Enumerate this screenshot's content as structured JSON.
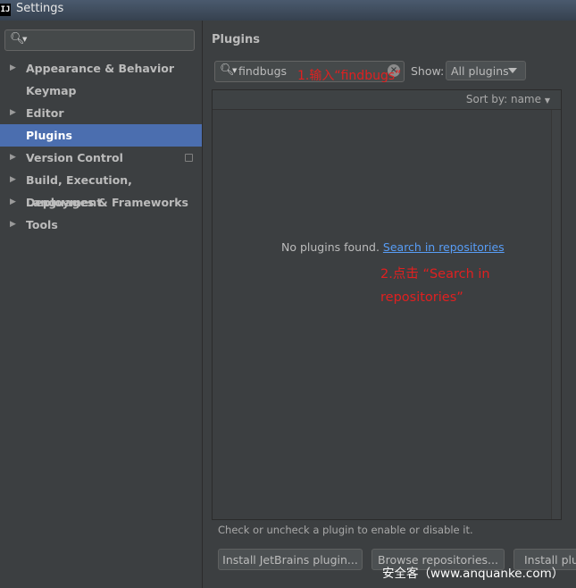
{
  "window": {
    "title": "Settings",
    "logo_text": "IJ"
  },
  "sidebar": {
    "search_icon": "search-icon",
    "items": [
      {
        "label": "Appearance & Behavior",
        "expandable": true
      },
      {
        "label": "Keymap",
        "expandable": false
      },
      {
        "label": "Editor",
        "expandable": true
      },
      {
        "label": "Plugins",
        "expandable": false,
        "selected": true
      },
      {
        "label": "Version Control",
        "expandable": true
      },
      {
        "label": "Build, Execution, Deployment",
        "expandable": true
      },
      {
        "label": "Languages & Frameworks",
        "expandable": true
      },
      {
        "label": "Tools",
        "expandable": true
      }
    ]
  },
  "main": {
    "title": "Plugins",
    "search": {
      "value": "findbugs"
    },
    "show": {
      "label": "Show:",
      "selected": "All plugins"
    },
    "sort": {
      "label": "Sort by: name"
    },
    "empty": {
      "text": "No plugins found.",
      "link": "Search in repositories"
    },
    "hint": "Check or uncheck a plugin to enable or disable it.",
    "buttons": {
      "install_jetbrains": "Install JetBrains plugin...",
      "browse": "Browse repositories...",
      "install_disk": "Install plugin from disk..."
    }
  },
  "annotations": {
    "step1": "1.输入“findbugs”",
    "step2_line1": "2.点击 “Search in",
    "step2_line2": "repositories”"
  },
  "watermark": "安全客（www.anquanke.com）",
  "colors": {
    "selection": "#4b6eaf",
    "link": "#589df6",
    "annotation": "#e02020",
    "background": "#3c3f41"
  }
}
